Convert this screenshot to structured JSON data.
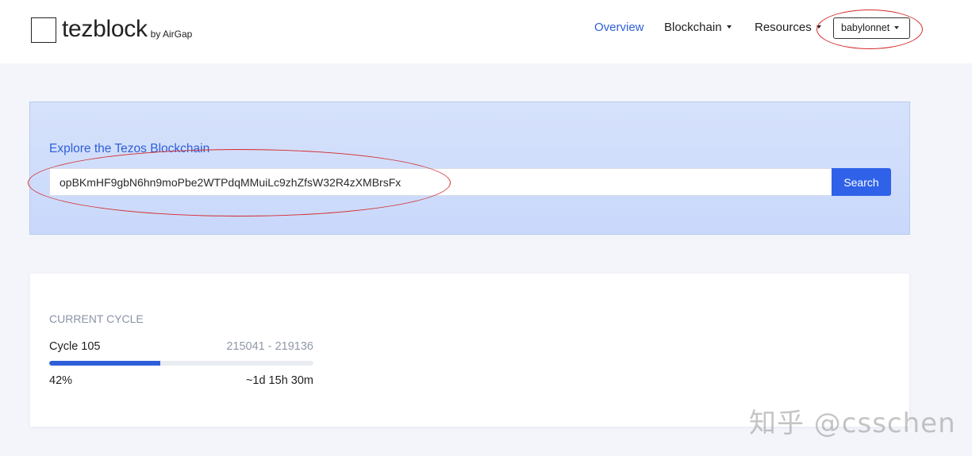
{
  "header": {
    "logo_text": "tezblock",
    "logo_by": "by AirGap",
    "nav": {
      "overview": "Overview",
      "blockchain": "Blockchain",
      "resources": "Resources"
    },
    "network": "babylonnet"
  },
  "search": {
    "title": "Explore the Tezos Blockchain",
    "value": "opBKmHF9gbN6hn9moPbe2WTPdqMMuiLc9zhZfsW32R4zXMBrsFx",
    "button_label": "Search"
  },
  "cycle": {
    "label": "CURRENT CYCLE",
    "name": "Cycle 105",
    "range": "215041 - 219136",
    "progress_percent": 42,
    "percent_label": "42%",
    "remaining": "~1d 15h 30m"
  },
  "watermark": "知乎 @csschen",
  "colors": {
    "accent": "#2f5fd8",
    "button": "#2f62e8",
    "annotation": "#d42a2a"
  }
}
